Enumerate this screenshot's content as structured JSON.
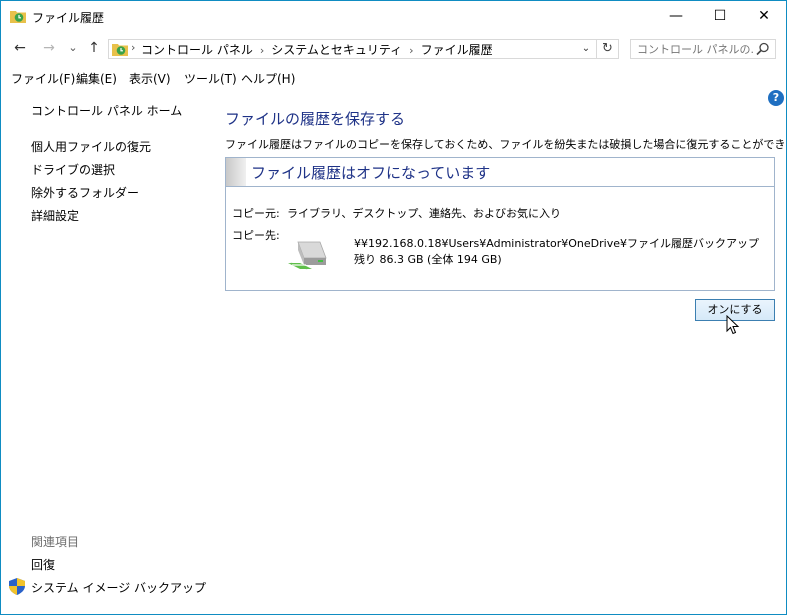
{
  "window": {
    "title": "ファイル履歴",
    "minimize_glyph": "—",
    "maximize_glyph": "☐",
    "close_glyph": "✕"
  },
  "nav": {
    "back_glyph": "←",
    "forward_glyph": "→",
    "recent_glyph": "⌄",
    "up_glyph": "↑",
    "refresh_glyph": "↻"
  },
  "address": {
    "crumbs": [
      "コントロール パネル",
      "システムとセキュリティ",
      "ファイル履歴"
    ],
    "separator": "›"
  },
  "search": {
    "placeholder": "コントロール パネルの..."
  },
  "menu": [
    "ファイル(F)",
    "編集(E)",
    "表示(V)",
    "ツール(T)",
    "ヘルプ(H)"
  ],
  "sidebar": {
    "home": "コントロール パネル ホーム",
    "links": [
      "個人用ファイルの復元",
      "ドライブの選択",
      "除外するフォルダー",
      "詳細設定"
    ],
    "related_header": "関連項目",
    "related": [
      "回復",
      "システム イメージ バックアップ"
    ]
  },
  "main": {
    "title": "ファイルの履歴を保存する",
    "description": "ファイル履歴はファイルのコピーを保存しておくため、ファイルを紛失または破損した場合に復元することができます。",
    "status_title": "ファイル履歴はオフになっています",
    "copy_from_label": "コピー元:",
    "copy_from_value": "ライブラリ、デスクトップ、連絡先、およびお気に入り",
    "copy_to_label": "コピー先:",
    "dest_path": "¥¥192.168.0.18¥Users¥Administrator¥OneDrive¥ファイル履歴バックアップ",
    "dest_free": "残り 86.3 GB (全体 194 GB)",
    "turn_on_button": "オンにする"
  },
  "help_glyph": "?",
  "colors": {
    "accent": "#1e3287",
    "border": "#0f8cc2",
    "help": "#1f6fc1"
  }
}
